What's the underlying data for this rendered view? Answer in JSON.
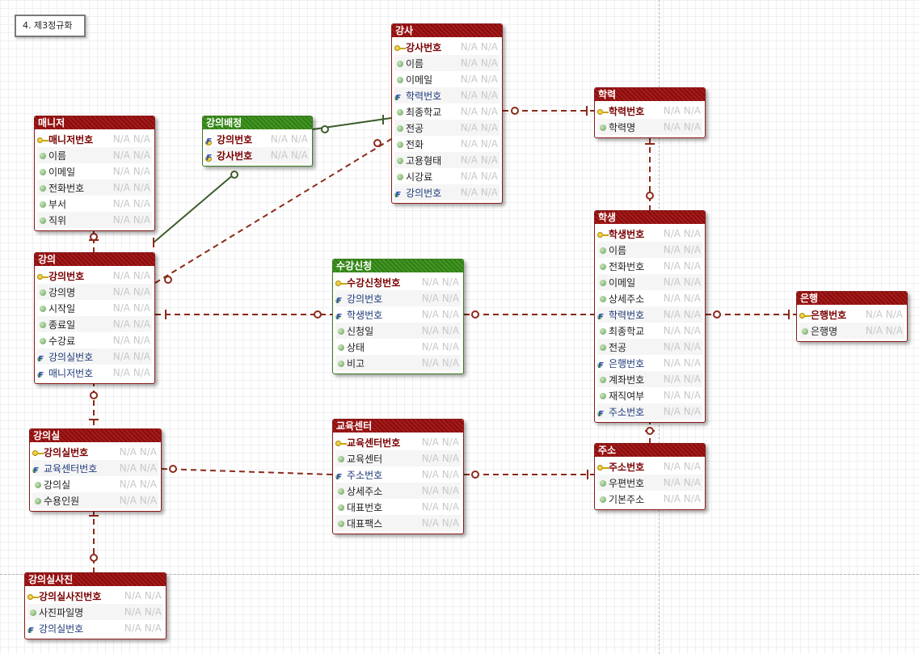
{
  "title": "4. 제3정규화",
  "placeholder": "N/A N/A",
  "entities": {
    "manager": {
      "name": "매니저",
      "attrs": [
        "매니저번호",
        "이름",
        "이메일",
        "전화번호",
        "부서",
        "직위"
      ]
    },
    "lecture": {
      "name": "강의",
      "attrs": [
        "강의번호",
        "강의명",
        "시작일",
        "종료일",
        "수강료",
        "강의실번호",
        "매니저번호"
      ]
    },
    "assign": {
      "name": "강의배정",
      "attrs": [
        "강의번호",
        "강사번호"
      ]
    },
    "instructor": {
      "name": "강사",
      "attrs": [
        "강사번호",
        "이름",
        "이메일",
        "학력번호",
        "최종학교",
        "전공",
        "전화",
        "고용형태",
        "시강료",
        "강의번호"
      ]
    },
    "education": {
      "name": "학력",
      "attrs": [
        "학력번호",
        "학력명"
      ]
    },
    "enroll": {
      "name": "수강신청",
      "attrs": [
        "수강신청번호",
        "강의번호",
        "학생번호",
        "신청일",
        "상태",
        "비고"
      ]
    },
    "student": {
      "name": "학생",
      "attrs": [
        "학생번호",
        "이름",
        "전화번호",
        "이메일",
        "상세주소",
        "학력번호",
        "최종학교",
        "전공",
        "은행번호",
        "계좌번호",
        "재직여부",
        "주소번호"
      ]
    },
    "bank": {
      "name": "은행",
      "attrs": [
        "은행번호",
        "은행명"
      ]
    },
    "room": {
      "name": "강의실",
      "attrs": [
        "강의실번호",
        "교육센터번호",
        "강의실",
        "수용인원"
      ]
    },
    "center": {
      "name": "교육센터",
      "attrs": [
        "교육센터번호",
        "교육센터",
        "주소번호",
        "상세주소",
        "대표번호",
        "대표팩스"
      ]
    },
    "address": {
      "name": "주소",
      "attrs": [
        "주소번호",
        "우편번호",
        "기본주소"
      ]
    },
    "photo": {
      "name": "강의실사진",
      "attrs": [
        "강의실사진번호",
        "사진파일명",
        "강의실번호"
      ]
    }
  }
}
